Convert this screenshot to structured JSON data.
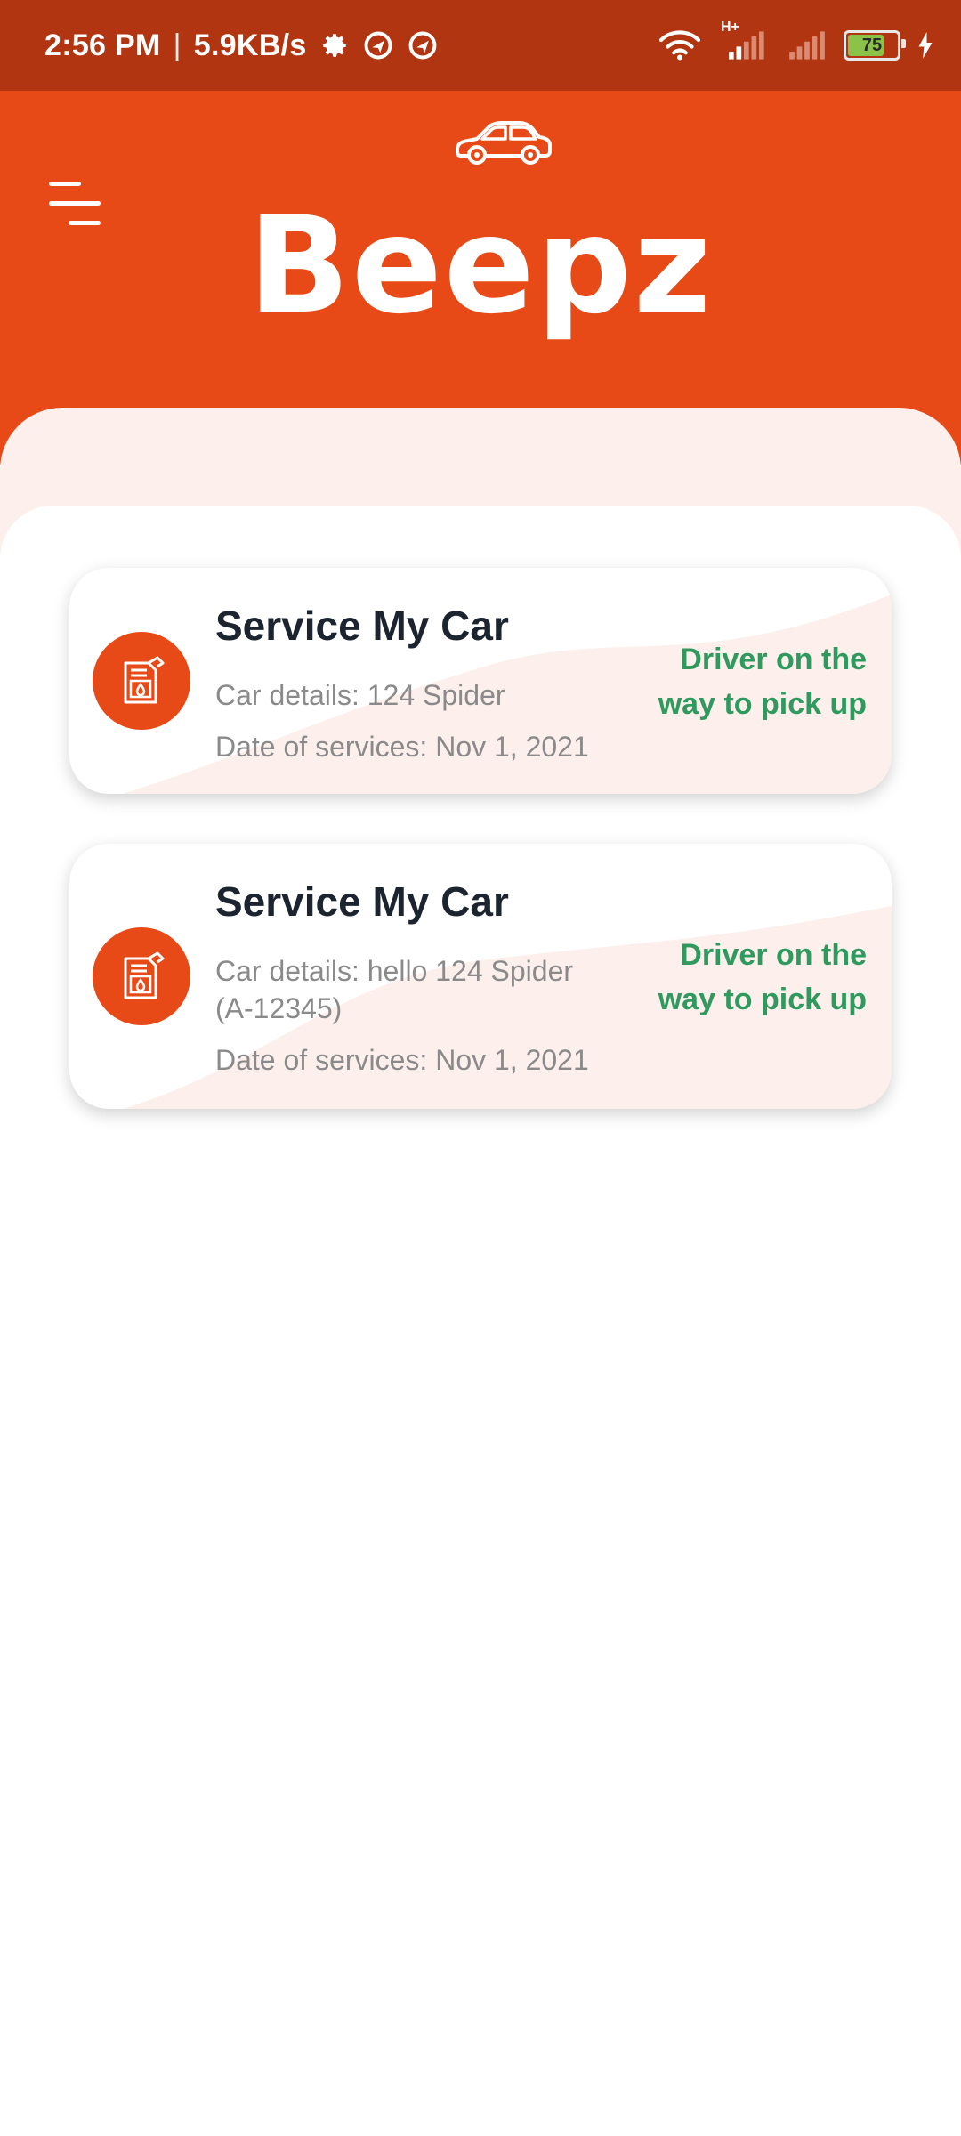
{
  "status_bar": {
    "time": "2:56 PM",
    "separator": "|",
    "net_speed": "5.9KB/s",
    "network_type": "H+",
    "battery_level": "75",
    "icons": [
      "gear-icon",
      "vpn-icon",
      "vpn-icon",
      "wifi-icon",
      "signal-icon",
      "signal-icon",
      "battery-icon",
      "charging-icon"
    ]
  },
  "header": {
    "title": "Beepz",
    "menu_icon": "menu-icon",
    "logo_icon": "car-icon",
    "background": "#e84a17"
  },
  "services": [
    {
      "title": "Service My Car",
      "car_details": "Car details: 124 Spider",
      "car_details_extra": "",
      "date": "Date of services: Nov 1, 2021",
      "status_line1": "Driver on the",
      "status_line2": "way to pick up",
      "icon": "fuel-can-icon"
    },
    {
      "title": "Service My Car",
      "car_details": "Car details: hello 124 Spider",
      "car_details_extra": "(A-12345)",
      "date": "Date of services: Nov 1, 2021",
      "status_line1": "Driver on the",
      "status_line2": "way to pick up",
      "icon": "fuel-can-icon"
    }
  ],
  "colors": {
    "accent": "#e84a17",
    "status_bar": "#b03510",
    "status_text": "#2f9a5e",
    "panel_tint": "#fcefec"
  }
}
